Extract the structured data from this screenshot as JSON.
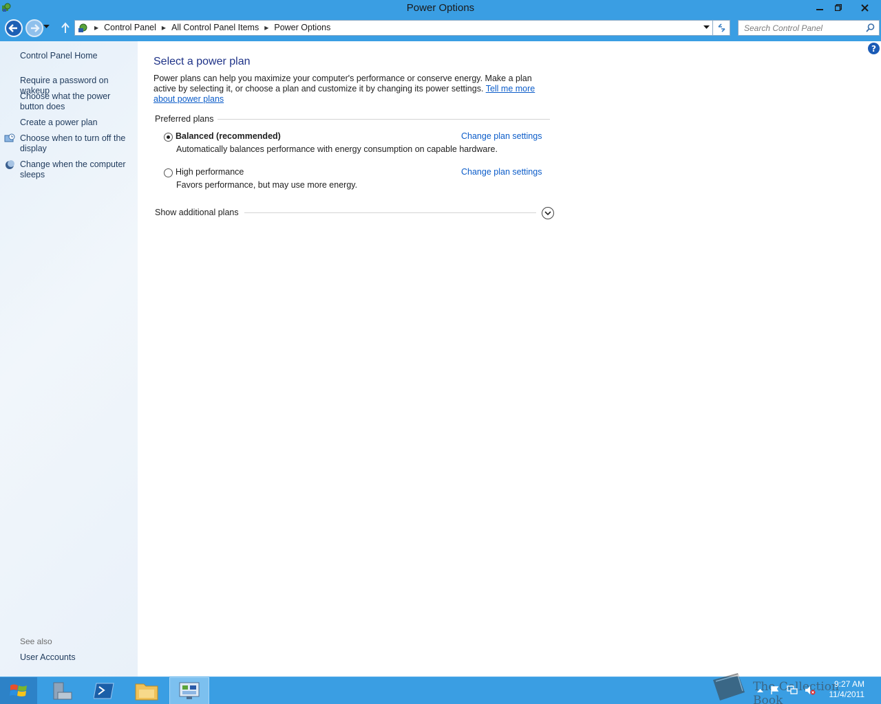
{
  "window": {
    "title": "Power Options",
    "controls": {
      "minimize": "minimize",
      "maximize": "maximize",
      "close": "close"
    }
  },
  "address": {
    "crumbs": [
      "Control Panel",
      "All Control Panel Items",
      "Power Options"
    ],
    "search_placeholder": "Search Control Panel"
  },
  "sidebar": {
    "home": "Control Panel Home",
    "links": [
      {
        "label": "Require a password on wakeup",
        "icon": ""
      },
      {
        "label": "Choose what the power button does",
        "icon": ""
      },
      {
        "label": "Create a power plan",
        "icon": ""
      },
      {
        "label": "Choose when to turn off the display",
        "icon": "display-clock-icon"
      },
      {
        "label": "Change when the computer sleeps",
        "icon": "moon-icon"
      }
    ],
    "see_also": "See also",
    "see_also_links": [
      "User Accounts"
    ]
  },
  "main": {
    "heading": "Select a power plan",
    "description": "Power plans can help you maximize your computer's performance or conserve energy. Make a plan active by selecting it, or choose a plan and customize it by changing its power settings. ",
    "description_link": "Tell me more about power plans",
    "preferred_label": "Preferred plans",
    "plans": [
      {
        "name": "Balanced (recommended)",
        "description": "Automatically balances performance with energy consumption on capable hardware.",
        "link": "Change plan settings",
        "selected": true
      },
      {
        "name": "High performance",
        "description": "Favors performance, but may use more energy.",
        "link": "Change plan settings",
        "selected": false
      }
    ],
    "additional_label": "Show additional plans"
  },
  "taskbar": {
    "time": "9:27 AM",
    "date": "11/4/2011",
    "watermark": "The Collection Book"
  },
  "colors": {
    "chrome": "#3a9ee3",
    "link": "#0b5cc9",
    "heading": "#1e3287",
    "sidebar_link": "#1e395b"
  }
}
